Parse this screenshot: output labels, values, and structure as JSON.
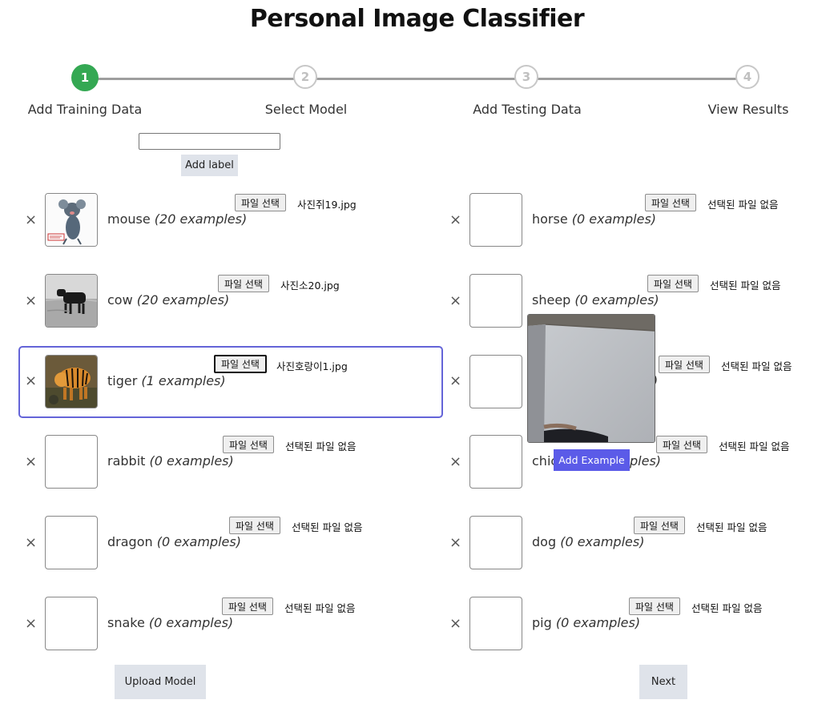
{
  "page": {
    "title": "Personal Image Classifier"
  },
  "stepper": {
    "steps": [
      {
        "number": "1",
        "label": "Add Training Data",
        "active": true
      },
      {
        "number": "2",
        "label": "Select Model",
        "active": false
      },
      {
        "number": "3",
        "label": "Add Testing Data",
        "active": false
      },
      {
        "number": "4",
        "label": "View Results",
        "active": false
      }
    ],
    "active_color": "#34a853"
  },
  "label_form": {
    "input_value": "",
    "add_label_button": "Add label"
  },
  "file_button_label": "파일 선택",
  "remove_glyph": "×",
  "classes": [
    {
      "name": "mouse",
      "count": "(20 examples)",
      "file": "사진쥐19.jpg",
      "thumbnail": "mouse-image"
    },
    {
      "name": "cow",
      "count": "(20 examples)",
      "file": "사진소20.jpg",
      "thumbnail": "cow-image"
    },
    {
      "name": "tiger",
      "count": "(1 examples)",
      "file": "사진호랑이1.jpg",
      "thumbnail": "tiger-image",
      "selected": true
    },
    {
      "name": "rabbit",
      "count": "(0 examples)",
      "file": "선택된 파일 없음"
    },
    {
      "name": "dragon",
      "count": "(0 examples)",
      "file": "선택된 파일 없음"
    },
    {
      "name": "snake",
      "count": "(0 examples)",
      "file": "선택된 파일 없음"
    },
    {
      "name": "horse",
      "count": "(0 examples)",
      "file": "선택된 파일 없음"
    },
    {
      "name": "sheep",
      "count": "(0 examples)",
      "file": "선택된 파일 없음"
    },
    {
      "name": "",
      "count": "",
      "file": "선택된 파일 없음",
      "hidden_by_overlay": true
    },
    {
      "name": "chic",
      "count": "ples)",
      "file": "선택된 파일 없음",
      "partially_hidden": true
    },
    {
      "name": "dog",
      "count": "(0 examples)",
      "file": "선택된 파일 없음"
    },
    {
      "name": "pig",
      "count": "(0 examples)",
      "file": "선택된 파일 없음"
    }
  ],
  "row8_visible_tail": ")",
  "webcam": {
    "add_example_button": "Add Example",
    "button_color": "#5b5be8"
  },
  "footer": {
    "upload_model_button": "Upload Model",
    "next_button": "Next"
  }
}
